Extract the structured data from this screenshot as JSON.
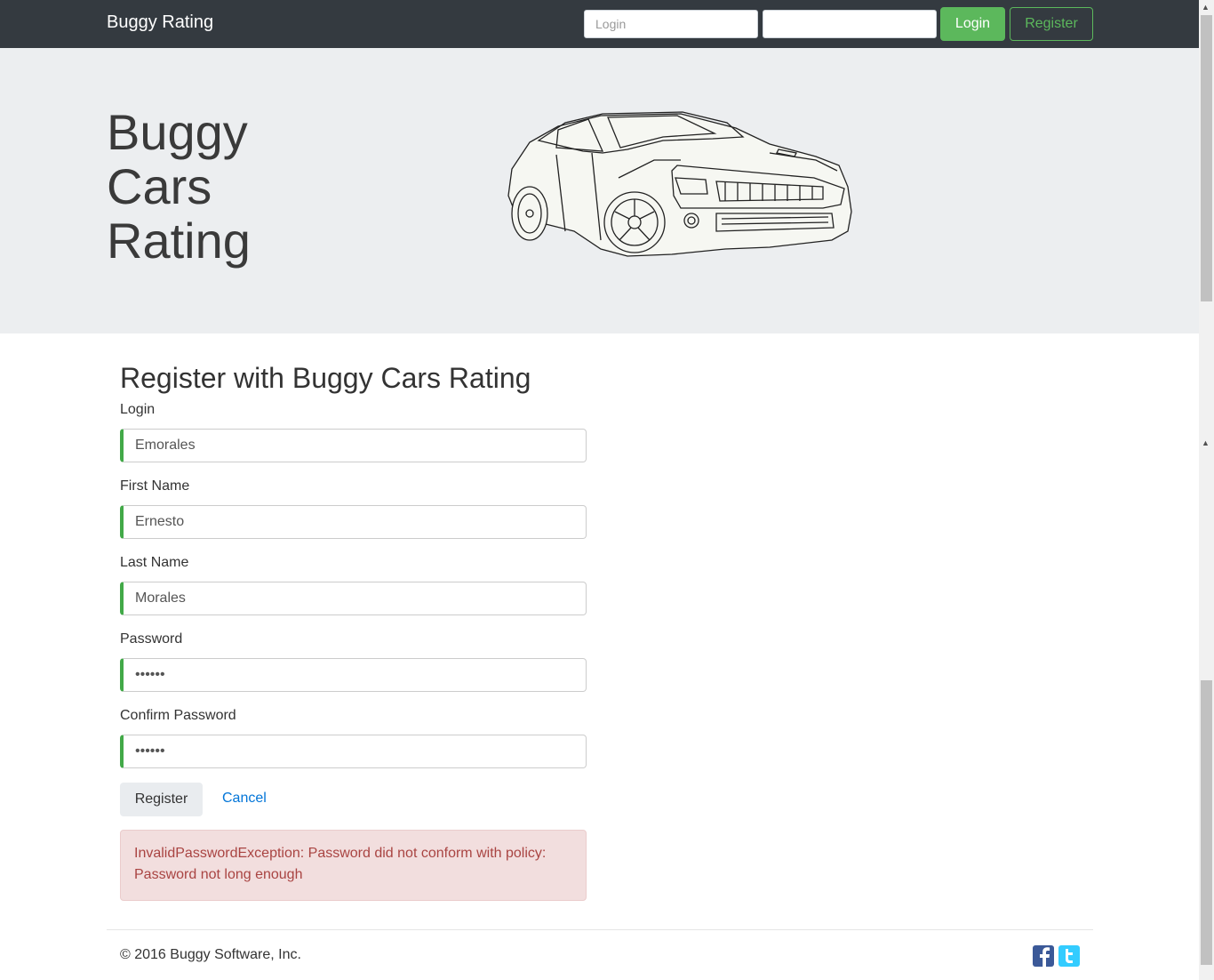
{
  "navbar": {
    "brand": "Buggy Rating",
    "login_placeholder": "Login",
    "password_placeholder": "",
    "login_button": "Login",
    "register_button": "Register"
  },
  "hero": {
    "title_lines": [
      "Buggy",
      "Cars",
      "Rating"
    ]
  },
  "form": {
    "title": "Register with Buggy Cars Rating",
    "fields": [
      {
        "label": "Login",
        "value": "Emorales"
      },
      {
        "label": "First Name",
        "value": "Ernesto"
      },
      {
        "label": "Last Name",
        "value": "Morales"
      },
      {
        "label": "Password",
        "value": "••••••"
      },
      {
        "label": "Confirm Password",
        "value": "••••••"
      }
    ],
    "submit": "Register",
    "cancel": "Cancel",
    "error_line1": "InvalidPasswordException: Password did not conform with policy:",
    "error_line2": "Password not long enough"
  },
  "footer": {
    "copyright": "© 2016 Buggy Software, Inc.",
    "icons": [
      "facebook-icon",
      "twitter-icon"
    ]
  },
  "colors": {
    "navbar": "#343a40",
    "success": "#5cb85c",
    "valid_border": "#42a948",
    "error_bg": "#f2dede",
    "error_text": "#a94442",
    "link": "#0275d8"
  }
}
